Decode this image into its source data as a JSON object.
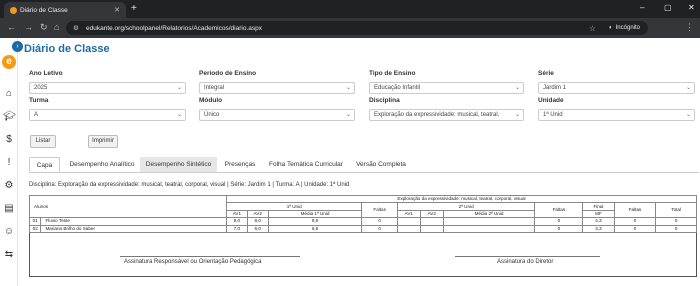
{
  "browser": {
    "tab_title": "Diário de Classe",
    "new_tab": "+",
    "url": "edukante.org/schoolpanel/Relatorios/Academicos/diario.aspx",
    "profile": "Incógnito",
    "window_controls": [
      "–",
      "▢",
      "✕"
    ]
  },
  "page": {
    "title": "Diário de Classe",
    "logo_letter": "e"
  },
  "sidebar": {
    "icons": [
      "home-icon",
      "graduation-icon",
      "dollar-icon",
      "alert-icon",
      "settings-icon",
      "report-icon",
      "user-icon",
      "swap-icon"
    ]
  },
  "filters": {
    "ano_letivo": {
      "label": "Ano Letivo",
      "value": "2025"
    },
    "periodo": {
      "label": "Período de Ensino",
      "value": "Integral"
    },
    "tipo": {
      "label": "Tipo de Ensino",
      "value": "Educação Infantil"
    },
    "serie": {
      "label": "Série",
      "value": "Jardim 1"
    },
    "turma": {
      "label": "Turma",
      "value": "A"
    },
    "modulo": {
      "label": "Módulo",
      "value": "Único"
    },
    "disciplina": {
      "label": "Disciplina",
      "value": "Exploração da expressividade: musical, teatral,"
    },
    "unidade": {
      "label": "Unidade",
      "value": "1ª Unid"
    }
  },
  "actions": {
    "listar": "Listar",
    "imprimir": "Imprimir"
  },
  "tabs": [
    "Capa",
    "Desempenho Analítico",
    "Desempenho Sintético",
    "Presenças",
    "Folha Temática Curricular",
    "Versão Completa"
  ],
  "info_line": "Disciplina: Exploração da expressividade: musical, teatral, corporal, visual | Série: Jardim 1 | Turma: A | Unidade: 1ª Unid",
  "report": {
    "discipline_header": "Exploração da expressividade: musical, teatral, corporal, visual",
    "col_alunos": "Alunos",
    "unid1": "1ª Unid",
    "unid2": "2ª Unid",
    "faltas": "Faltas",
    "final": "Final",
    "mf": "MF",
    "total": "Total",
    "av1": "AV1",
    "av2": "AV2",
    "media1": "Média 1ª Unid",
    "media2": "Média 2ª Unid",
    "rows": [
      {
        "num": "01",
        "name": "Fluvio Teste",
        "av1": "9,0",
        "av2": "8,0",
        "media": "8,5",
        "faltas1": "0",
        "av1b": "",
        "av2b": "",
        "media2": "",
        "faltas2": "0",
        "mf": "4,3",
        "faltas": "0",
        "total": "0"
      },
      {
        "num": "02",
        "name": "Mariana Brilho do Saber",
        "av1": "7,0",
        "av2": "6,0",
        "media": "6,5",
        "faltas1": "0",
        "av1b": "",
        "av2b": "",
        "media2": "",
        "faltas2": "0",
        "mf": "3,3",
        "faltas": "0",
        "total": "0"
      }
    ]
  },
  "signatures": {
    "left": "Assinatura Responsável ou Orientação Pedagógica",
    "right": "Assinatura do Diretor"
  }
}
